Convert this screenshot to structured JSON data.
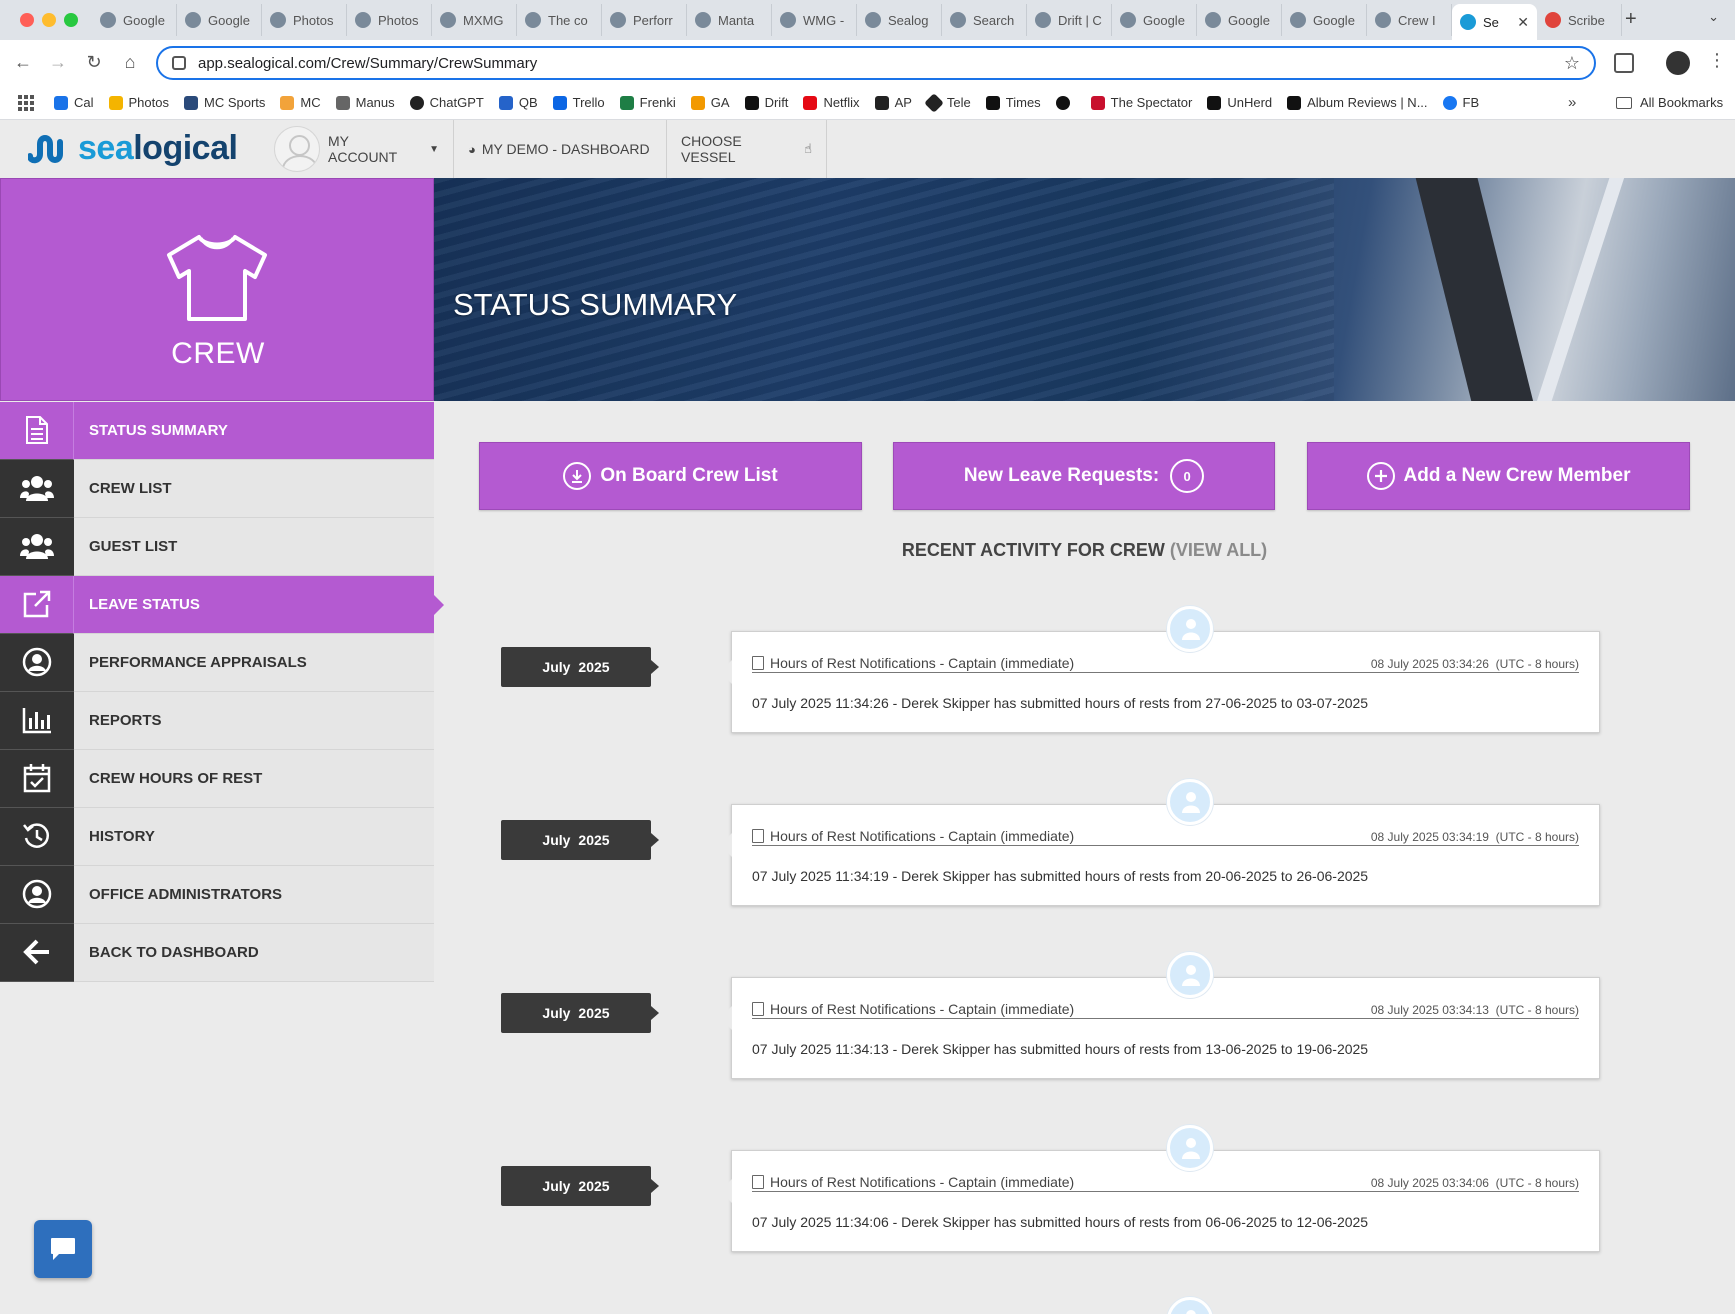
{
  "browser": {
    "tabs": [
      "Google",
      "Google",
      "Photos",
      "Photos",
      "MXMG",
      "The co",
      "Perforr",
      "Manta",
      "WMG -",
      "Sealog",
      "Search",
      "Drift | C",
      "Google",
      "Google",
      "Google",
      "Crew I",
      "Se",
      "Scribe"
    ],
    "active_tab_index": 16,
    "url": "app.sealogical.com/Crew/Summary/CrewSummary",
    "bookmarks": [
      "Cal",
      "Photos",
      "MC Sports",
      "MC",
      "Manus",
      "ChatGPT",
      "QB",
      "Trello",
      "Frenki",
      "GA",
      "Drift",
      "Netflix",
      "AP",
      "Tele",
      "Times",
      "",
      "The Spectator",
      "UnHerd",
      "Album Reviews | N...",
      "FB"
    ],
    "all_bookmarks": "All Bookmarks",
    "more_glyph": "»",
    "new_tab_glyph": "+",
    "close_glyph": "✕"
  },
  "header": {
    "logo_sea": "sea",
    "logo_logical": "logical",
    "my_account": "MY ACCOUNT",
    "demo_dashboard": "MY DEMO - DASHBOARD",
    "choose_vessel": "CHOOSE VESSEL"
  },
  "sidebar": {
    "section_title": "CREW",
    "items": [
      {
        "label": "STATUS SUMMARY",
        "icon": "document-icon",
        "active": true
      },
      {
        "label": "CREW LIST",
        "icon": "users-icon",
        "active": false
      },
      {
        "label": "GUEST LIST",
        "icon": "users-icon",
        "active": false
      },
      {
        "label": "LEAVE STATUS",
        "icon": "external-link-icon",
        "active": true
      },
      {
        "label": "PERFORMANCE APPRAISALS",
        "icon": "user-circle-icon",
        "active": false
      },
      {
        "label": "REPORTS",
        "icon": "bar-chart-icon",
        "active": false
      },
      {
        "label": "CREW HOURS OF REST",
        "icon": "calendar-check-icon",
        "active": false
      },
      {
        "label": "HISTORY",
        "icon": "history-icon",
        "active": false
      },
      {
        "label": "OFFICE ADMINISTRATORS",
        "icon": "user-circle-icon",
        "active": false
      },
      {
        "label": "BACK TO DASHBOARD",
        "icon": "arrow-left-icon",
        "active": false
      }
    ]
  },
  "main": {
    "banner_title": "STATUS SUMMARY",
    "buttons": {
      "onboard": "On Board Crew List",
      "leave_requests": "New Leave Requests:",
      "leave_count": "0",
      "add_member": "Add a New Crew Member"
    },
    "recent_title": "RECENT ACTIVITY FOR CREW",
    "view_all": "(VIEW ALL)",
    "activities": [
      {
        "month": "July",
        "year": "2025",
        "title": "Hours of Rest Notifications - Captain (immediate)",
        "timestamp": "08 July 2025 03:34:26",
        "tz": "(UTC - 8 hours)",
        "body": "07 July 2025 11:34:26 - Derek Skipper has submitted hours of rests from 27-06-2025 to 03-07-2025"
      },
      {
        "month": "July",
        "year": "2025",
        "title": "Hours of Rest Notifications - Captain (immediate)",
        "timestamp": "08 July 2025 03:34:19",
        "tz": "(UTC - 8 hours)",
        "body": "07 July 2025 11:34:19 - Derek Skipper has submitted hours of rests from 20-06-2025 to 26-06-2025"
      },
      {
        "month": "July",
        "year": "2025",
        "title": "Hours of Rest Notifications - Captain (immediate)",
        "timestamp": "08 July 2025 03:34:13",
        "tz": "(UTC - 8 hours)",
        "body": "07 July 2025 11:34:13 - Derek Skipper has submitted hours of rests from 13-06-2025 to 19-06-2025"
      },
      {
        "month": "July",
        "year": "2025",
        "title": "Hours of Rest Notifications - Captain (immediate)",
        "timestamp": "08 July 2025 03:34:06",
        "tz": "(UTC - 8 hours)",
        "body": "07 July 2025 11:34:06 - Derek Skipper has submitted hours of rests from 06-06-2025 to 12-06-2025"
      }
    ]
  },
  "colors": {
    "accent": "#b45ad1",
    "dark_icon": "#333333",
    "date_box": "#3a3a3a",
    "chat": "#2e6fbd"
  }
}
